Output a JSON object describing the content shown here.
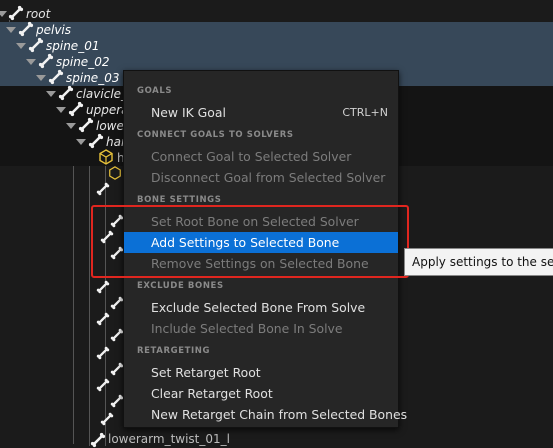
{
  "tree": {
    "rows": [
      {
        "label": "root"
      },
      {
        "label": "pelvis"
      },
      {
        "label": "spine_01"
      },
      {
        "label": "spine_02"
      },
      {
        "label": "spine_03"
      },
      {
        "label": "clavicle_l"
      },
      {
        "label": "upperarm_l"
      },
      {
        "label": "lowerarm_l"
      },
      {
        "label": "hand_l"
      },
      {
        "label": "h"
      },
      {
        "label": "lowerarm_twist_01_l"
      }
    ]
  },
  "menu": {
    "sections": {
      "goals": "GOALS",
      "connect": "CONNECT GOALS TO SOLVERS",
      "bone_settings": "BONE SETTINGS",
      "exclude": "EXCLUDE BONES",
      "retargeting": "RETARGETING"
    },
    "items": {
      "new_ik_goal": "New IK Goal",
      "new_ik_goal_shortcut": "CTRL+N",
      "connect_goal": "Connect Goal to Selected Solver",
      "disconnect_goal": "Disconnect Goal from Selected Solver",
      "set_root_bone": "Set Root Bone on Selected Solver",
      "add_settings": "Add Settings to Selected Bone",
      "remove_settings": "Remove Settings on Selected Bone",
      "exclude_bone": "Exclude Selected Bone From Solve",
      "include_bone": "Include Selected Bone In Solve",
      "set_retarget_root": "Set Retarget Root",
      "clear_retarget_root": "Clear Retarget Root",
      "new_retarget_chain": "New Retarget Chain from Selected Bones"
    }
  },
  "tooltip": {
    "text": "Apply settings to the selected bone."
  },
  "colors": {
    "highlight": "#0b70d6",
    "selection_row": "#374859",
    "annotation_box": "#e0261f"
  },
  "icons": {
    "bone": "bone-icon",
    "expander": "expander-arrow-icon",
    "goal": "cube-icon"
  }
}
